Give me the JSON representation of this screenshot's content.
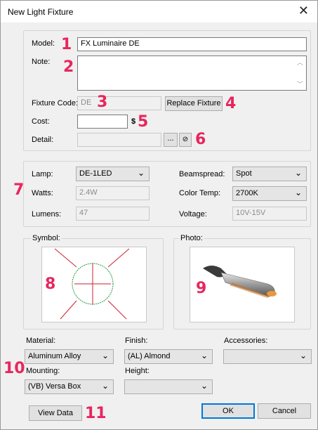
{
  "window": {
    "title": "New Light Fixture",
    "close_glyph": "✕"
  },
  "general": {
    "model_label": "Model:",
    "model_value": "FX Luminaire DE",
    "note_label": "Note:",
    "note_value": "",
    "fixture_code_label": "Fixture Code:",
    "fixture_code_value": "DE",
    "replace_button": "Replace Fixture",
    "cost_label": "Cost:",
    "cost_value": "",
    "currency": "$",
    "detail_label": "Detail:",
    "detail_value": "",
    "browse_button": "...",
    "clear_glyph": "⊘"
  },
  "lamp": {
    "lamp_label": "Lamp:",
    "lamp_value": "DE-1LED",
    "watts_label": "Watts:",
    "watts_value": "2.4W",
    "lumens_label": "Lumens:",
    "lumens_value": "47",
    "beamspread_label": "Beamspread:",
    "beamspread_value": "Spot",
    "color_temp_label": "Color Temp:",
    "color_temp_value": "2700K",
    "voltage_label": "Voltage:",
    "voltage_value": "10V-15V"
  },
  "symbol": {
    "label": "Symbol:"
  },
  "photo": {
    "label": "Photo:"
  },
  "details": {
    "material_label": "Material:",
    "material_value": "Aluminum Alloy",
    "finish_label": "Finish:",
    "finish_value": "(AL) Almond",
    "accessories_label": "Accessories:",
    "accessories_value": "",
    "mounting_label": "Mounting:",
    "mounting_value": "(VB) Versa Box",
    "height_label": "Height:",
    "height_value": ""
  },
  "footer": {
    "view_data": "View Data",
    "ok": "OK",
    "cancel": "Cancel"
  },
  "callouts": [
    "1",
    "2",
    "3",
    "4",
    "5",
    "6",
    "7",
    "8",
    "9",
    "10",
    "11"
  ],
  "colors": {
    "callout": "#e8265e",
    "accent": "#0078d7",
    "symbol_line": "#cc1f2f",
    "symbol_circle": "#2a9a4a"
  },
  "icons": {
    "dropdown": "chevron-down-icon",
    "scroll_up": "scroll-up-icon",
    "scroll_down": "scroll-down-icon"
  }
}
